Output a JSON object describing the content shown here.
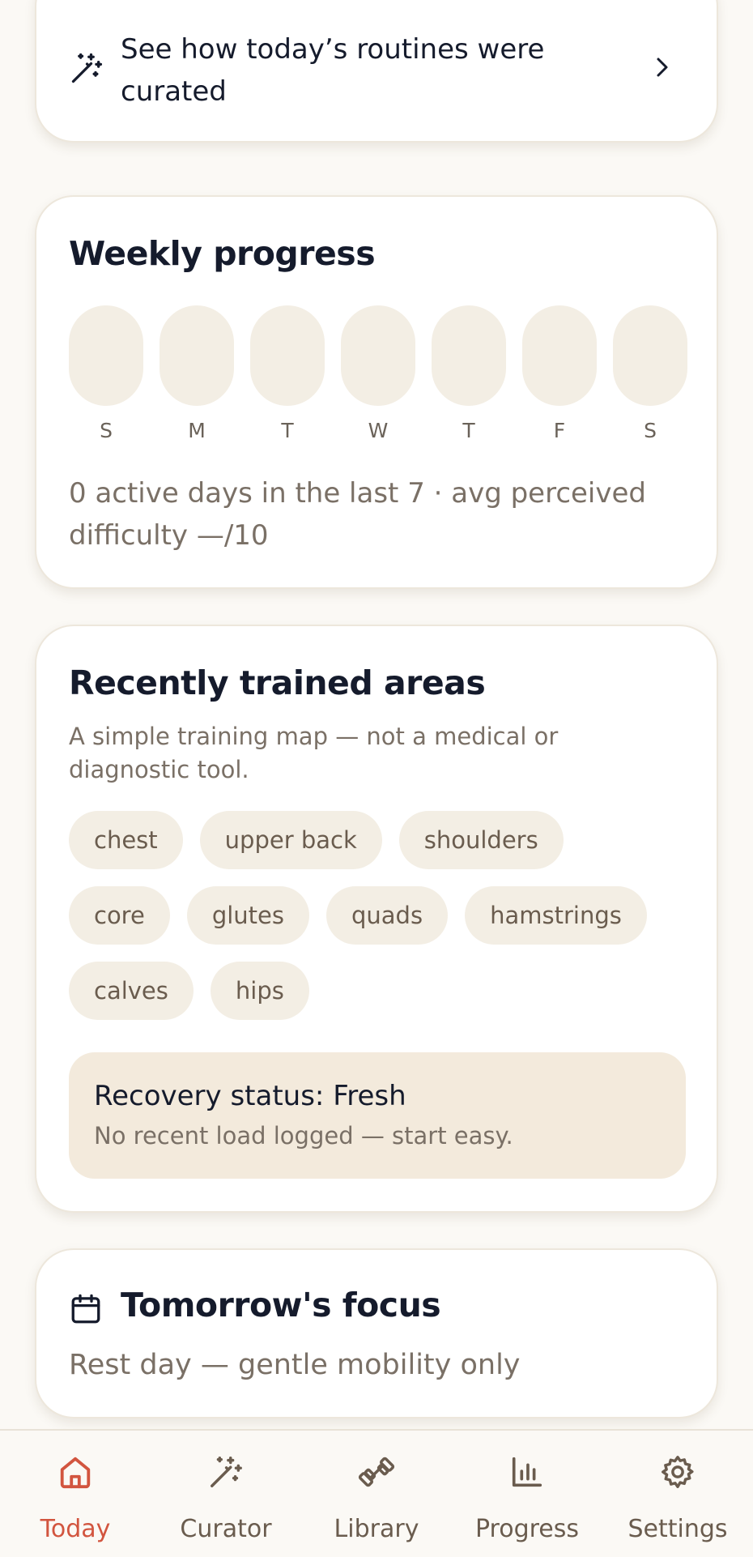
{
  "curated_banner": {
    "text": "See how today’s routines were curated",
    "icon": "magic-wand-icon",
    "chevron_icon": "chevron-right-icon"
  },
  "weekly_progress": {
    "title": "Weekly progress",
    "days": [
      {
        "label": "S",
        "active": false
      },
      {
        "label": "M",
        "active": false
      },
      {
        "label": "T",
        "active": false
      },
      {
        "label": "W",
        "active": false
      },
      {
        "label": "T",
        "active": false
      },
      {
        "label": "F",
        "active": false
      },
      {
        "label": "S",
        "active": false
      }
    ],
    "summary": "0 active days in the last 7 · avg perceived difficulty —/10"
  },
  "trained_areas": {
    "title": "Recently trained areas",
    "subtitle": "A simple training map — not a medical or diagnostic tool.",
    "chips": [
      "chest",
      "upper back",
      "shoulders",
      "core",
      "glutes",
      "quads",
      "hamstrings",
      "calves",
      "hips"
    ],
    "recovery": {
      "title": "Recovery status: Fresh",
      "subtitle": "No recent load logged — start easy."
    }
  },
  "tomorrow": {
    "title": "Tomorrow's focus",
    "icon": "calendar-icon",
    "focus": "Rest day — gentle mobility only"
  },
  "nav": {
    "items": [
      {
        "label": "Today",
        "icon": "home-icon",
        "active": true
      },
      {
        "label": "Curator",
        "icon": "magic-wand-icon",
        "active": false
      },
      {
        "label": "Library",
        "icon": "dumbbell-icon",
        "active": false
      },
      {
        "label": "Progress",
        "icon": "bar-chart-icon",
        "active": false
      },
      {
        "label": "Settings",
        "icon": "gear-icon",
        "active": false
      }
    ]
  },
  "colors": {
    "background": "#FBF9F5",
    "card": "#FFFFFF",
    "chip": "#F3EEE4",
    "recovery_bg": "#F3EADC",
    "accent": "#D2553F",
    "text": "#151B2C",
    "muted": "#7A7066"
  }
}
